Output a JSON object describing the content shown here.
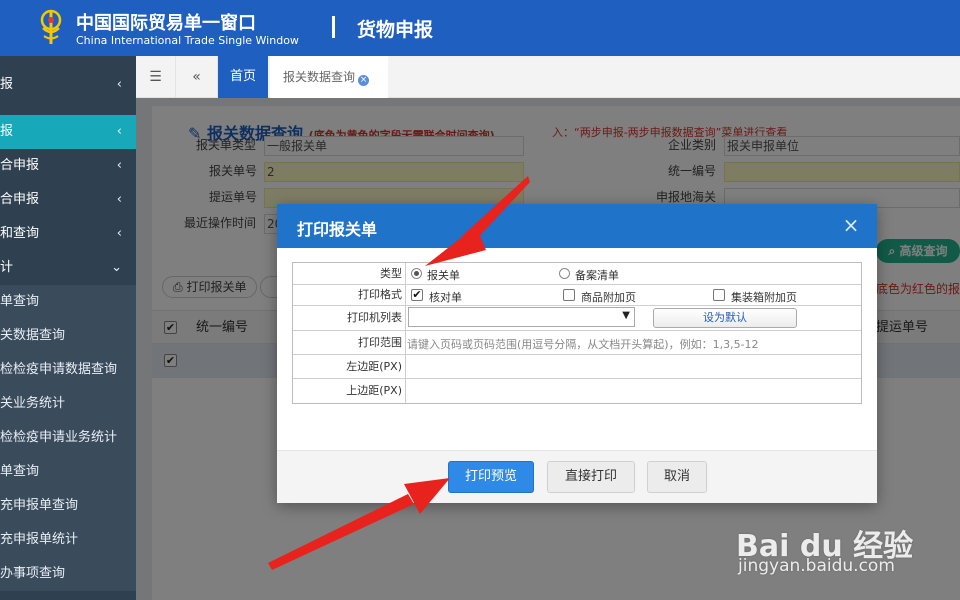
{
  "header": {
    "brand_cn": "中国国际贸易单一窗口",
    "brand_en": "China International Trade Single Window",
    "separator": "|",
    "title": "货物申报"
  },
  "sidebar": {
    "items": [
      {
        "label": "报",
        "chevron": "‹"
      },
      {
        "label": "报",
        "chevron": "‹"
      },
      {
        "label": "合申报",
        "chevron": "‹"
      },
      {
        "label": "合申报",
        "chevron": "‹"
      },
      {
        "label": "和查询",
        "chevron": "‹"
      },
      {
        "label": "计",
        "chevron": "⌄"
      },
      {
        "label": "单查询"
      },
      {
        "label": "关数据查询"
      },
      {
        "label": "检检疫申请数据查询"
      },
      {
        "label": "关业务统计"
      },
      {
        "label": "检检疫申请业务统计"
      },
      {
        "label": "单查询"
      },
      {
        "label": "充申报单查询"
      },
      {
        "label": "充申报单统计"
      },
      {
        "label": "办事项查询"
      }
    ]
  },
  "tabs": {
    "menu_icon": "☰",
    "back_icon": "«",
    "home": "首页",
    "current": "报关数据查询",
    "close": "×"
  },
  "query": {
    "title": "报关数据查询",
    "note": "(底色为黄色的字段无需联合时间查询)",
    "red_note": "入：“两步申报-两步申报数据查询”菜单进行查看",
    "fields": {
      "decl_type_label": "报关单类型",
      "decl_type_value": "一般报关单",
      "decl_no_label": "报关单号",
      "decl_no_value": "2",
      "bl_label": "提运单号",
      "recent_time_label": "最近操作时间",
      "recent_time_value": "20",
      "company_type_label": "企业类别",
      "company_type_value": "报关申报单位",
      "unified_no_label": "统一编号",
      "customs_label": "申报地海关"
    },
    "advanced_button": "高级查询",
    "print_button": "打印报关单",
    "red_tip": "底色为红色的报",
    "table": {
      "col_unified": "统一编号",
      "col_bl": "提运单号"
    }
  },
  "dialog": {
    "title": "打印报关单",
    "close": "×",
    "rows": {
      "type_label": "类型",
      "type_opt1": "报关单",
      "type_opt2": "备案清单",
      "format_label": "打印格式",
      "format_opt1": "核对单",
      "format_opt2": "商品附加页",
      "format_opt3": "集装箱附加页",
      "printer_label": "打印机列表",
      "printer_value": "",
      "set_default": "设为默认",
      "range_label": "打印范围",
      "range_placeholder": "请键入页码或页码范围(用逗号分隔，从文档开头算起)，例如：1,3,5-12",
      "left_margin_label": "左边距(PX)",
      "top_margin_label": "上边距(PX)"
    },
    "buttons": {
      "preview": "打印预览",
      "direct": "直接打印",
      "cancel": "取消"
    }
  },
  "watermark": {
    "text": "Bai du 经验",
    "url": "jingyan.baidu.com"
  },
  "colors": {
    "header_blue": "#1f5fbf",
    "sidebar_dark": "#2f4050",
    "sidebar_active": "#17a8b9",
    "arrow_red": "#e8221c",
    "primary_button": "#2e8ae6"
  }
}
